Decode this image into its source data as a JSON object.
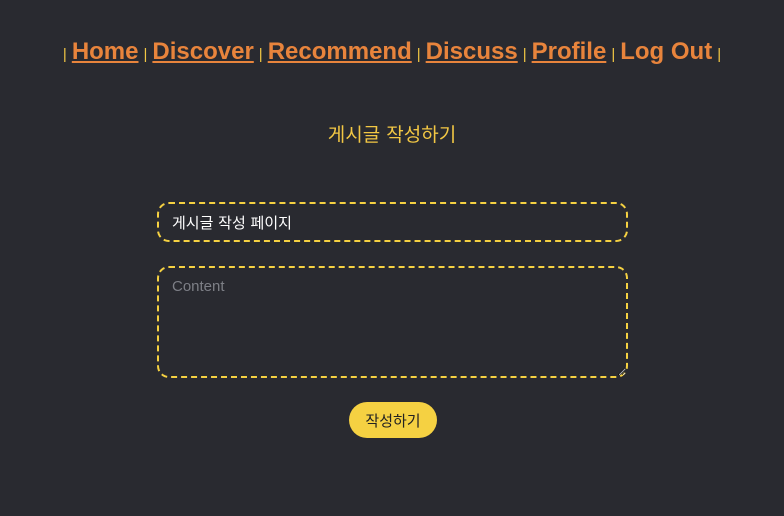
{
  "nav": {
    "separator": "|",
    "items": [
      {
        "label": "Home"
      },
      {
        "label": "Discover"
      },
      {
        "label": "Recommend"
      },
      {
        "label": "Discuss"
      },
      {
        "label": "Profile"
      },
      {
        "label": "Log Out"
      }
    ]
  },
  "page": {
    "title": "게시글 작성하기"
  },
  "form": {
    "title_value": "게시글 작성 페이지",
    "content_placeholder": "Content",
    "submit_label": "작성하기"
  },
  "colors": {
    "background": "#292a30",
    "link": "#e8843c",
    "accent": "#f5d142"
  }
}
